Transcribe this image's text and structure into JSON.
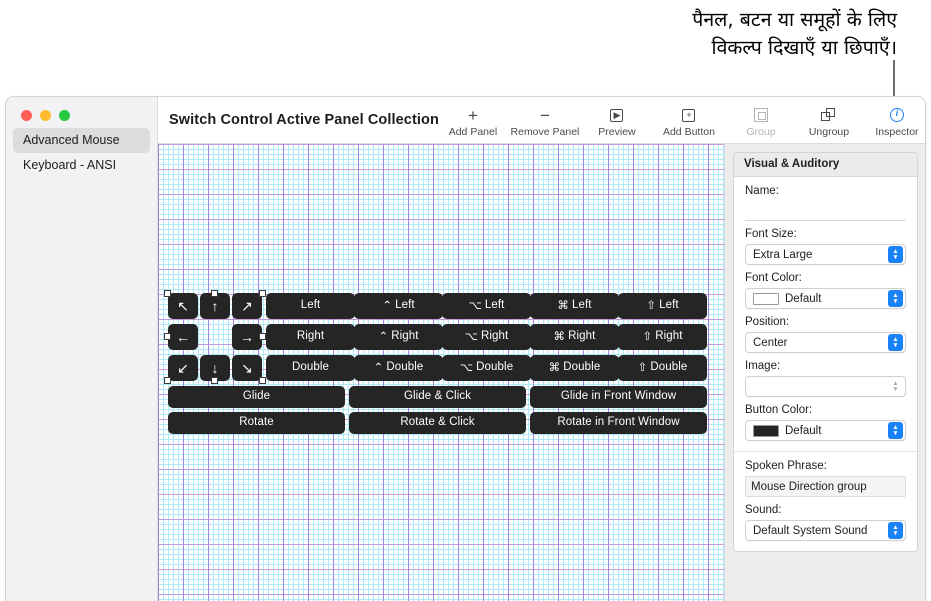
{
  "callout": {
    "text": "पैनल, बटन या समूहों के लिए\nविकल्प दिखाएँ या छिपाएँ।"
  },
  "window": {
    "title": "Switch Control Active Panel Collection"
  },
  "sidebar": {
    "items": [
      {
        "label": "Advanced Mouse",
        "selected": true
      },
      {
        "label": "Keyboard - ANSI",
        "selected": false
      }
    ]
  },
  "toolbar": {
    "items": [
      {
        "label": "Add Panel",
        "icon": "plus-icon",
        "glyph": "+",
        "state": "normal"
      },
      {
        "label": "Remove Panel",
        "icon": "minus-icon",
        "glyph": "−",
        "state": "normal"
      },
      {
        "label": "Preview",
        "icon": "preview-icon",
        "glyph": "▶",
        "state": "normal"
      },
      {
        "label": "Add Button",
        "icon": "add-button-icon",
        "glyph": "+",
        "state": "normal"
      },
      {
        "label": "Group",
        "icon": "group-icon",
        "glyph": "",
        "state": "disabled"
      },
      {
        "label": "Ungroup",
        "icon": "ungroup-icon",
        "glyph": "",
        "state": "normal"
      },
      {
        "label": "Inspector",
        "icon": "info-icon",
        "glyph": "i",
        "state": "active"
      }
    ]
  },
  "canvas": {
    "direction_buttons": [
      {
        "glyph": "↖",
        "name": "up-left-arrow"
      },
      {
        "glyph": "↑",
        "name": "up-arrow"
      },
      {
        "glyph": "↗",
        "name": "up-right-arrow"
      },
      {
        "glyph": "←",
        "name": "left-arrow"
      },
      {
        "glyph": "→",
        "name": "right-arrow"
      },
      {
        "glyph": "↙",
        "name": "down-left-arrow"
      },
      {
        "glyph": "↓",
        "name": "down-arrow"
      },
      {
        "glyph": "↘",
        "name": "down-right-arrow"
      }
    ],
    "click_columns": [
      {
        "modifier": "",
        "labels": [
          "Left",
          "Right",
          "Double"
        ]
      },
      {
        "modifier": "⌃",
        "labels": [
          "Left",
          "Right",
          "Double"
        ]
      },
      {
        "modifier": "⌥",
        "labels": [
          "Left",
          "Right",
          "Double"
        ]
      },
      {
        "modifier": "⌘",
        "labels": [
          "Left",
          "Right",
          "Double"
        ]
      },
      {
        "modifier": "⇧",
        "labels": [
          "Left",
          "Right",
          "Double"
        ]
      }
    ],
    "wide_buttons": [
      {
        "label": "Glide"
      },
      {
        "label": "Glide & Click"
      },
      {
        "label": "Glide in Front Window"
      },
      {
        "label": "Rotate"
      },
      {
        "label": "Rotate & Click"
      },
      {
        "label": "Rotate in Front Window"
      }
    ]
  },
  "inspector": {
    "header": "Visual & Auditory",
    "name_label": "Name:",
    "name_value": "",
    "font_size_label": "Font Size:",
    "font_size_value": "Extra Large",
    "font_color_label": "Font Color:",
    "font_color_value": "Default",
    "font_color_swatch": "#ffffff",
    "position_label": "Position:",
    "position_value": "Center",
    "image_label": "Image:",
    "image_value": "",
    "button_color_label": "Button Color:",
    "button_color_value": "Default",
    "button_color_swatch": "#252525",
    "spoken_phrase_label": "Spoken Phrase:",
    "spoken_phrase_value": "Mouse Direction group",
    "sound_label": "Sound:",
    "sound_value": "Default System Sound"
  },
  "colors": {
    "accent": "#1a82f7",
    "button_fill": "#252525",
    "grid_minor": "#aeeaf5",
    "grid_major": "#b28fdd"
  }
}
